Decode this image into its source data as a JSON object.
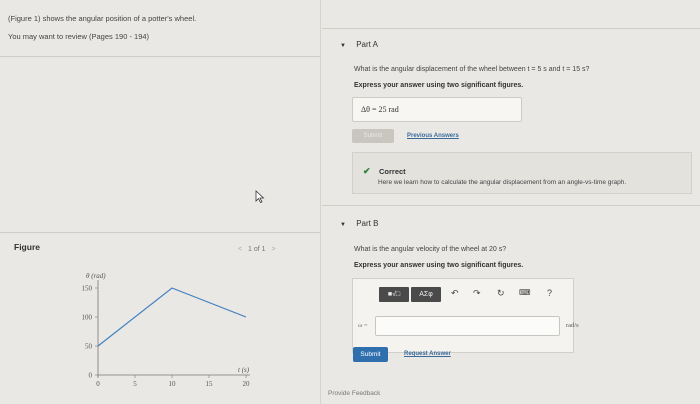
{
  "intro": {
    "line1": "(Figure 1) shows the angular position of a potter's wheel.",
    "line2": "You may want to review (Pages 190 - 194)"
  },
  "figure": {
    "label": "Figure",
    "pager_text": "1 of 1",
    "prev_icon": "chevron-left-icon",
    "next_icon": "chevron-right-icon"
  },
  "chart_data": {
    "type": "line",
    "title": "",
    "ylabel": "θ (rad)",
    "xlabel": "t (s)",
    "x_ticks": [
      "0",
      "5",
      "10",
      "15",
      "20"
    ],
    "y_ticks": [
      "0",
      "50",
      "100",
      "150"
    ],
    "xlim": [
      0,
      20
    ],
    "ylim": [
      0,
      150
    ],
    "series": [
      {
        "x": [
          0,
          10,
          20
        ],
        "y": [
          50,
          150,
          100
        ]
      }
    ],
    "color": "#3f7fc2",
    "grid": false
  },
  "partA": {
    "title": "Part A",
    "question": "What is the angular displacement of the wheel between t = 5 s and t = 15 s?",
    "instruction": "Express your answer using two significant figures.",
    "answer_text": "Δθ = 25 rad",
    "submit_label": "Submit",
    "prev_answers_link": "Previous Answers",
    "correct_label": "Correct",
    "correct_text": "Here we learn how to calculate the angular displacement from an angle-vs-time graph."
  },
  "partB": {
    "title": "Part B",
    "question": "What is the angular velocity of the wheel at 20 s?",
    "instruction": "Express your answer using two significant figures.",
    "toolbar": {
      "templates_icon": "templates-icon",
      "symbols_label": "ΑΣφ",
      "undo_icon": "undo-icon",
      "redo_icon": "redo-icon",
      "reset_icon": "reset-icon",
      "keyboard_icon": "keyboard-icon",
      "help_label": "?"
    },
    "variable_label": "ω =",
    "unit": "rad/s",
    "input_value": "",
    "submit_label": "Submit",
    "request_answer_link": "Request Answer"
  },
  "feedback_link": "Provide Feedback",
  "colors": {
    "accent": "#2f6fae",
    "correct": "#2f7d3a",
    "link": "#3a6a9a"
  }
}
